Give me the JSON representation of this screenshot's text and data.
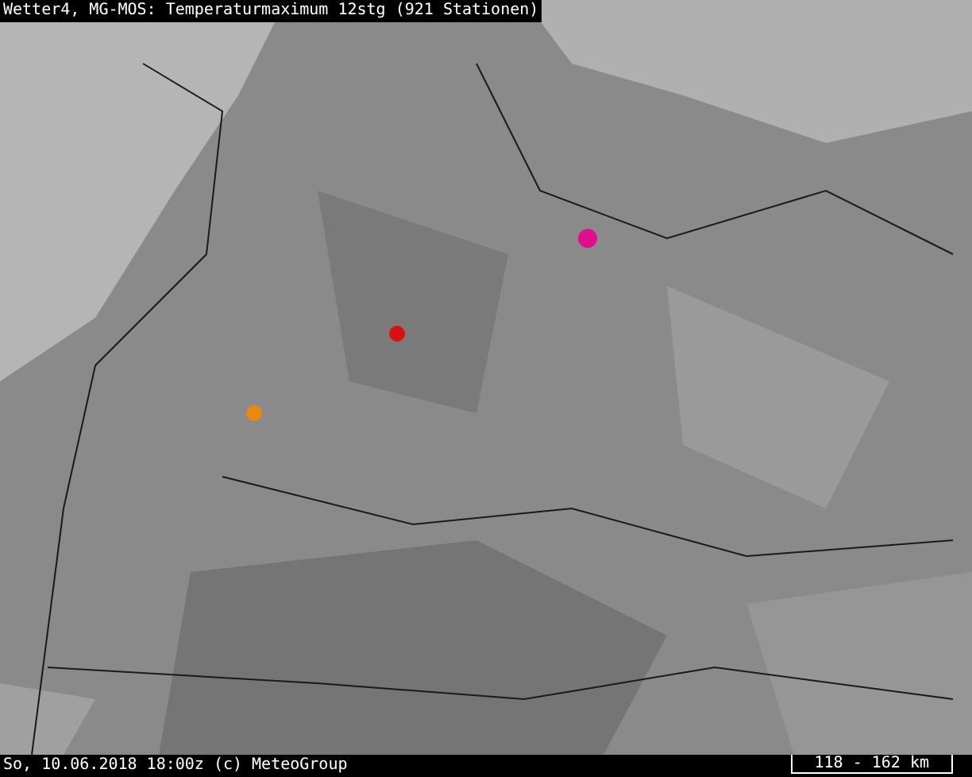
{
  "title": "Wetter4, MG-MOS: Temperaturmaximum 12stg (921 Stationen)",
  "footer": {
    "timestamp": "So, 10.06.2018 18:00z (c) MeteoGroup",
    "scale": "118 - 162 km"
  }
}
